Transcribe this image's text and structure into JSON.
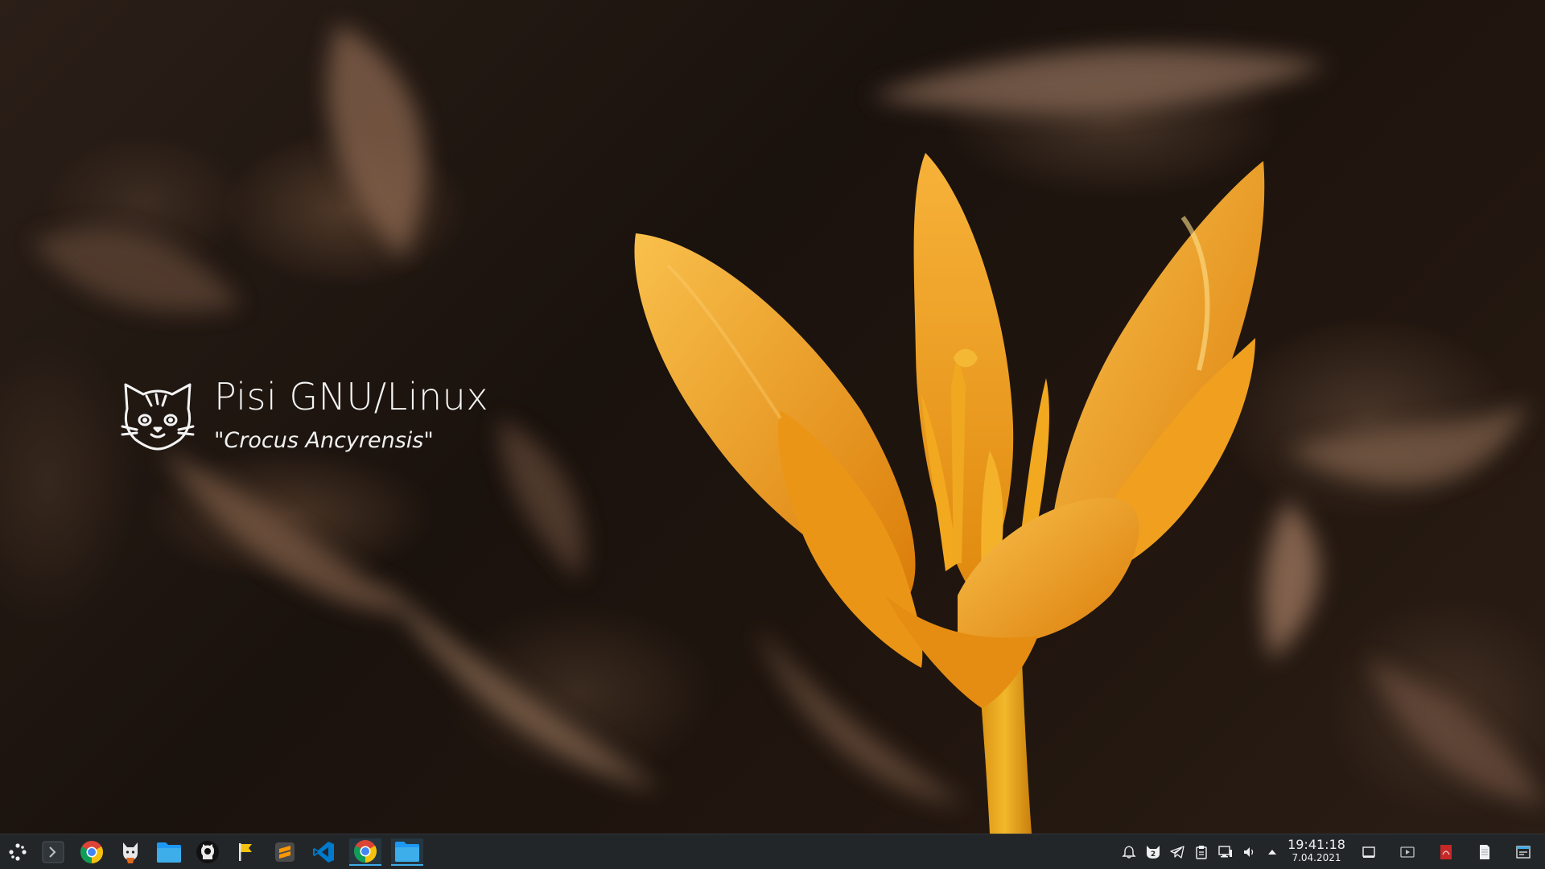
{
  "desktop": {
    "brand_title": "Pisi GNU/Linux",
    "brand_subtitle": "\"Crocus Ancyrensis\""
  },
  "taskbar": {
    "launcher": [
      {
        "name": "application-menu-icon"
      },
      {
        "name": "terminal-icon"
      },
      {
        "name": "chrome-icon"
      },
      {
        "name": "cat-app-icon"
      },
      {
        "name": "file-manager-icon"
      },
      {
        "name": "github-icon"
      },
      {
        "name": "flag-icon"
      },
      {
        "name": "sublime-text-icon"
      },
      {
        "name": "vscode-icon"
      }
    ],
    "tasks": [
      {
        "name": "chrome-window-icon"
      },
      {
        "name": "file-manager-window-icon"
      }
    ],
    "tray": [
      {
        "name": "notifications-icon"
      },
      {
        "name": "cat-badge-icon",
        "badge": "2"
      },
      {
        "name": "telegram-icon"
      },
      {
        "name": "clipboard-icon"
      },
      {
        "name": "network-icon"
      },
      {
        "name": "volume-icon"
      },
      {
        "name": "expand-tray-icon"
      }
    ],
    "clock": {
      "time": "19:41:18",
      "date": "7.04.2021"
    },
    "right_icons": [
      {
        "name": "show-desktop-icon"
      },
      {
        "name": "media-player-icon"
      },
      {
        "name": "pdf-viewer-icon"
      },
      {
        "name": "document-icon"
      },
      {
        "name": "panel-config-icon"
      }
    ]
  },
  "colors": {
    "taskbar_bg": "#232629",
    "accent": "#3daee9",
    "petal": "#f3a01c",
    "stem": "#eaa51a"
  }
}
